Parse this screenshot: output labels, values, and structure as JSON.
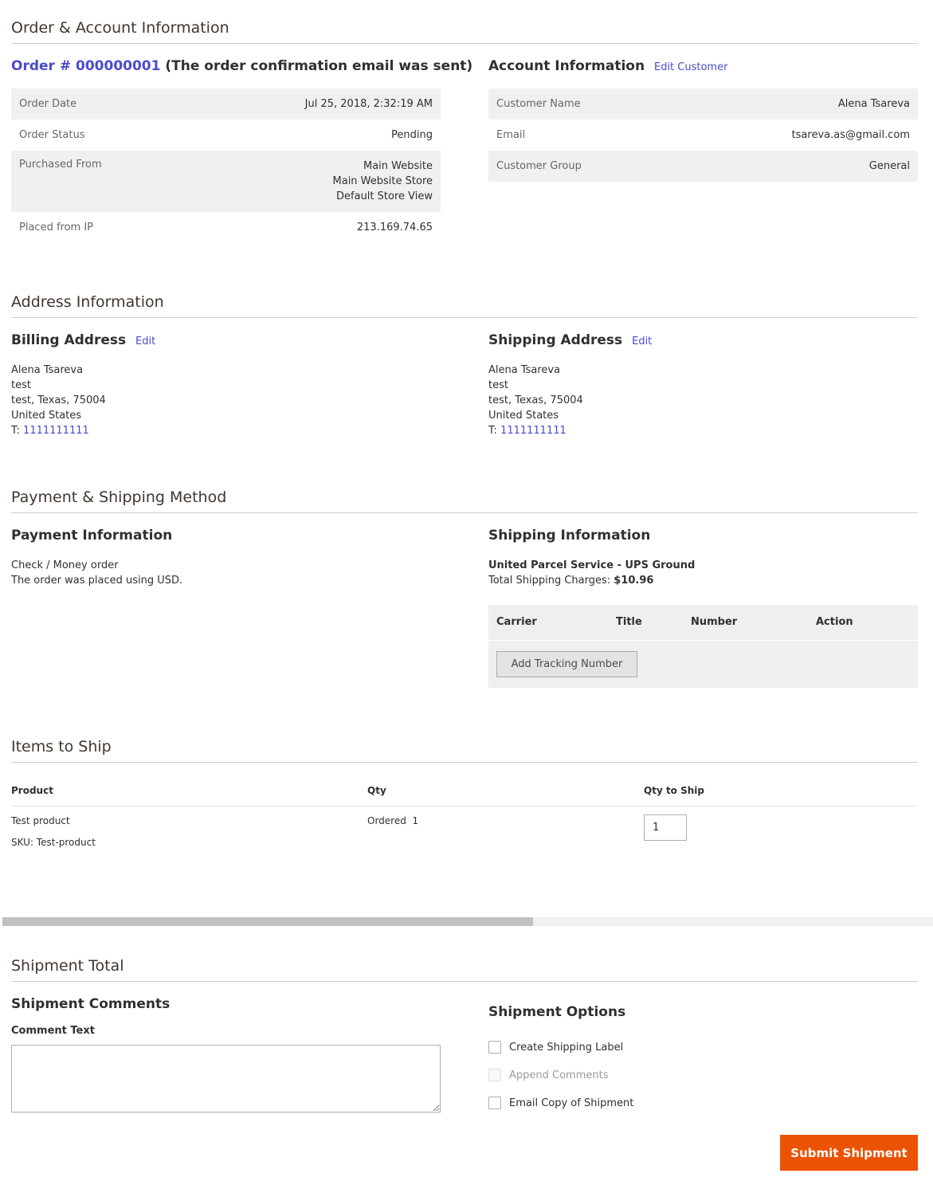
{
  "order_account": {
    "section_title": "Order & Account Information",
    "order_link": "Order # 000000001",
    "order_note": "(The order confirmation email was sent)",
    "order_rows": [
      {
        "label": "Order Date",
        "value": "Jul 25, 2018, 2:32:19 AM"
      },
      {
        "label": "Order Status",
        "value": "Pending"
      },
      {
        "label": "Purchased From",
        "value_lines": [
          "Main Website",
          "Main Website Store",
          "Default Store View"
        ]
      },
      {
        "label": "Placed from IP",
        "value": "213.169.74.65"
      }
    ],
    "account_title": "Account Information",
    "edit_customer": "Edit Customer",
    "account_rows": [
      {
        "label": "Customer Name",
        "value": "Alena Tsareva"
      },
      {
        "label": "Email",
        "value": "tsareva.as@gmail.com"
      },
      {
        "label": "Customer Group",
        "value": "General"
      }
    ]
  },
  "address": {
    "section_title": "Address Information",
    "billing_title": "Billing Address",
    "shipping_title": "Shipping Address",
    "edit_label": "Edit",
    "billing_lines": [
      "Alena Tsareva",
      "test",
      "test, Texas, 75004",
      "United States"
    ],
    "shipping_lines": [
      "Alena Tsareva",
      "test",
      "test, Texas, 75004",
      "United States"
    ],
    "phone_prefix": "T:",
    "billing_phone": "1111111111",
    "shipping_phone": "1111111111"
  },
  "payment_shipping": {
    "section_title": "Payment & Shipping Method",
    "payment_title": "Payment Information",
    "payment_method": "Check / Money order",
    "payment_note": "The order was placed using USD.",
    "shipping_title": "Shipping Information",
    "shipping_method": "United Parcel Service - UPS Ground",
    "charges_label": "Total Shipping Charges:",
    "charges_value": "$10.96",
    "tracking_headers": [
      "Carrier",
      "Title",
      "Number",
      "Action"
    ],
    "add_tracking": "Add Tracking Number"
  },
  "items": {
    "section_title": "Items to Ship",
    "headers": {
      "product": "Product",
      "qty": "Qty",
      "qty_to_ship": "Qty to Ship"
    },
    "rows": [
      {
        "name": "Test product",
        "sku": "SKU: Test-product",
        "ordered_label": "Ordered",
        "ordered_qty": "1",
        "qty_to_ship": "1"
      }
    ]
  },
  "scrollbar": {
    "position_fraction": 0.57
  },
  "shipment_total": {
    "section_title": "Shipment Total",
    "comments_title": "Shipment Comments",
    "comment_label": "Comment Text",
    "comment_value": "",
    "options_title": "Shipment Options",
    "options": [
      {
        "label": "Create Shipping Label",
        "checked": false,
        "disabled": false
      },
      {
        "label": "Append Comments",
        "checked": false,
        "disabled": true
      },
      {
        "label": "Email Copy of Shipment",
        "checked": false,
        "disabled": false
      }
    ],
    "submit_label": "Submit Shipment",
    "submit_color": "#eb5202"
  }
}
